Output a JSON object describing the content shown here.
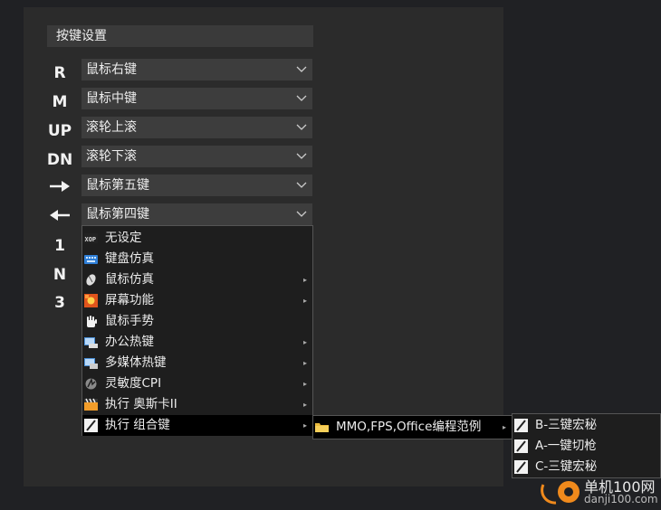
{
  "section_title": "按键设置",
  "rows": [
    {
      "key": "R",
      "value": "鼠标右键"
    },
    {
      "key": "M",
      "value": "鼠标中键"
    },
    {
      "key": "UP",
      "value": "滚轮上滚"
    },
    {
      "key": "DN",
      "value": "滚轮下滚"
    },
    {
      "key": "right-arrow",
      "value": "鼠标第五键"
    },
    {
      "key": "left-arrow",
      "value": "鼠标第四键"
    }
  ],
  "extra_keys": [
    "1",
    "N",
    "3"
  ],
  "menu": [
    {
      "label": "无设定",
      "icon": "xop-icon",
      "submenu": false
    },
    {
      "label": "键盘仿真",
      "icon": "keyboard-icon",
      "submenu": false
    },
    {
      "label": "鼠标仿真",
      "icon": "mouse-icon",
      "submenu": true
    },
    {
      "label": "屏幕功能",
      "icon": "screen-icon",
      "submenu": true
    },
    {
      "label": "鼠标手势",
      "icon": "hand-icon",
      "submenu": false
    },
    {
      "label": "办公热键",
      "icon": "office-icon",
      "submenu": true
    },
    {
      "label": "多媒体热键",
      "icon": "media-icon",
      "submenu": true
    },
    {
      "label": "灵敏度CPI",
      "icon": "sensitivity-icon",
      "submenu": true
    },
    {
      "label": "执行 奥斯卡II",
      "icon": "clapper-icon",
      "submenu": true
    },
    {
      "label": "执行 组合键",
      "icon": "combo-icon",
      "submenu": true
    }
  ],
  "submenu": {
    "label": "MMO,FPS,Office编程范例",
    "icon": "folder-icon"
  },
  "submenu2": [
    {
      "label": "B-三键宏秘"
    },
    {
      "label": "A-一键切枪"
    },
    {
      "label": "C-三键宏秘"
    }
  ],
  "watermark": {
    "line1": "单机100网",
    "line2": "danji100.com"
  },
  "colors": {
    "background": "#202124",
    "panel": "#2b2b2b",
    "dropdown": "#3d3d3d",
    "menu": "#1e1e1e",
    "highlight": "#000000"
  }
}
